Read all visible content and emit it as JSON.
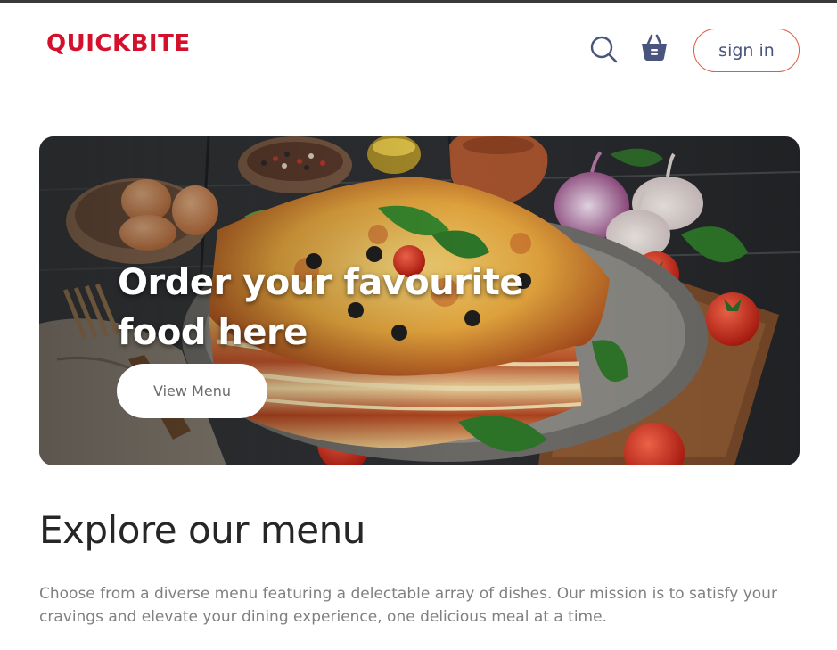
{
  "header": {
    "logo_text": "QUICKBITE",
    "signin_label": "sign in",
    "icons": [
      "search-icon",
      "basket-icon"
    ]
  },
  "hero": {
    "title": "Order your favourite food here",
    "button_label": "View Menu"
  },
  "explore": {
    "title": "Explore our menu",
    "description": "Choose from a diverse menu featuring a delectable array of dishes. Our mission is to satisfy your cravings and elevate your dining experience, one delicious meal at a time."
  },
  "colors": {
    "brand": "#d4112c",
    "accent_border": "#e35a3d",
    "icon": "#49557e",
    "text_dark": "#262626",
    "text_muted": "#808080"
  }
}
